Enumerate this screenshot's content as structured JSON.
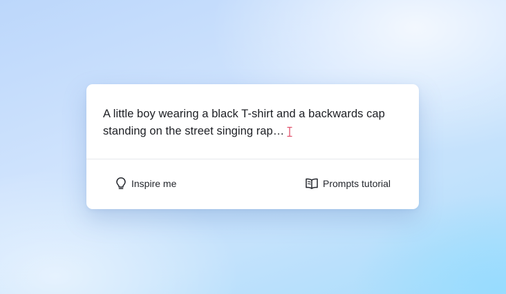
{
  "prompt": {
    "text": "A little boy wearing a black T-shirt and a backwards cap standing on the street singing rap…",
    "cursor_icon": "text-cursor-icon",
    "cursor_color": "#e0506a"
  },
  "actions": {
    "inspire": {
      "label": "Inspire me",
      "icon": "lightbulb-icon"
    },
    "tutorial": {
      "label": "Prompts tutorial",
      "icon": "open-book-icon"
    }
  },
  "colors": {
    "card_background": "#ffffff",
    "text": "#1d1f24",
    "divider": "#e6e8ec"
  }
}
